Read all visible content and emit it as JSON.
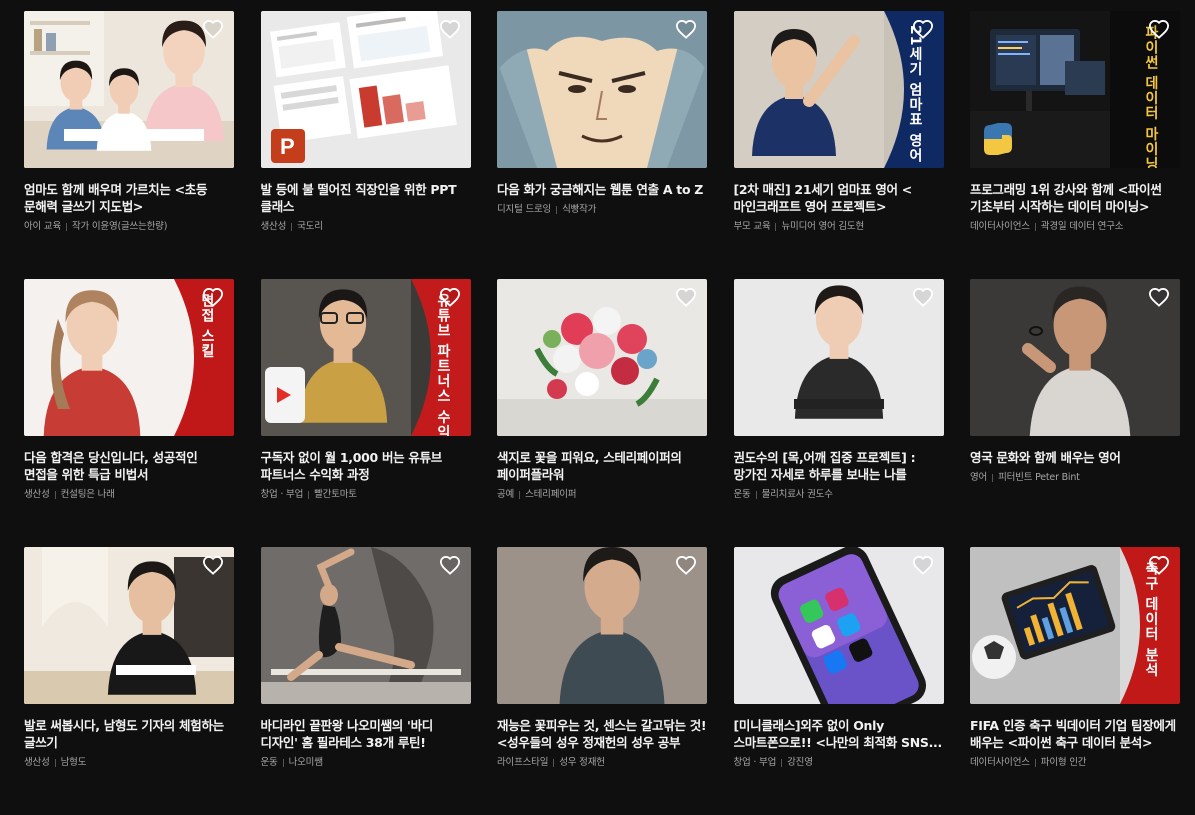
{
  "colors": {
    "background": "#0f0f0f",
    "accent_red": "#d21f1f",
    "accent_navy": "#0f2a63"
  },
  "cards": [
    {
      "title": "엄마도 함께 배우며 가르치는 <초등 문해력 글쓰기 지도법>",
      "category": "아이 교육",
      "creator": "작가 이윤영(글쓰는한량)",
      "overlay_text": "",
      "icon": "heart-outline-icon"
    },
    {
      "title": "발 등에 불 떨어진 직장인을 위한 PPT 클래스",
      "category": "생산성",
      "creator": "국도리",
      "overlay_text": "",
      "icon": "heart-outline-icon"
    },
    {
      "title": "다음 화가 궁금해지는 웹툰 연출 A to Z",
      "category": "디지털 드로잉",
      "creator": "식빵작가",
      "overlay_text": "",
      "icon": "heart-outline-icon"
    },
    {
      "title": "[2차 매진] 21세기 엄마표 영어 < 마인크래프트 영어 프로젝트>",
      "category": "부모 교육",
      "creator": "뉴미디어 영어 김도현",
      "overlay_text": "21세기 엄마표 영어",
      "icon": "heart-outline-icon"
    },
    {
      "title": "프로그래밍 1위 강사와 함께 <파이썬 기초부터 시작하는 데이터 마이닝>",
      "category": "데이터사이언스",
      "creator": "곽경일 데이터 연구소",
      "overlay_text": "파이썬 데이터 마이닝",
      "icon": "heart-outline-icon"
    },
    {
      "title": "다음 합격은 당신입니다, 성공적인 면접을 위한 특급 비법서",
      "category": "생산성",
      "creator": "컨설팅은 나래",
      "overlay_text": "면접 스킬",
      "icon": "heart-outline-icon"
    },
    {
      "title": "구독자 없이 월 1,000 버는 유튜브 파트너스 수익화 과정",
      "category": "창업 · 부업",
      "creator": "빨간토마토",
      "overlay_text": "유튜브 파트너스 수익화",
      "icon": "heart-outline-icon"
    },
    {
      "title": "색지로 꽃을 피워요, 스테리페이퍼의 페이퍼플라워",
      "category": "공예",
      "creator": "스테리페이퍼",
      "overlay_text": "",
      "icon": "heart-outline-icon"
    },
    {
      "title": "권도수의 [목,어깨 집중 프로젝트] : 망가진 자세로 하루를 보내는 나를 위한...",
      "category": "운동",
      "creator": "물리치료사 권도수",
      "overlay_text": "",
      "icon": "heart-outline-icon"
    },
    {
      "title": "영국 문화와 함께 배우는 영어",
      "category": "영어",
      "creator": "피터빈트 Peter Bint",
      "overlay_text": "",
      "icon": "heart-outline-icon"
    },
    {
      "title": "발로 써봅시다, 남형도 기자의 체험하는 글쓰기",
      "category": "생산성",
      "creator": "남형도",
      "overlay_text": "",
      "icon": "heart-outline-icon"
    },
    {
      "title": "바디라인 끝판왕 나오미쌤의 '바디 디자인' 홈 필라테스 38개 루틴!",
      "category": "운동",
      "creator": "나오미쌤",
      "overlay_text": "",
      "icon": "heart-outline-icon"
    },
    {
      "title": "재능은 꽃피우는 것, 센스는 갈고닦는 것! <성우들의 성우 정재헌의 성우 공부 비...",
      "category": "라이프스타일",
      "creator": "성우 정재헌",
      "overlay_text": "",
      "icon": "heart-outline-icon"
    },
    {
      "title": "[미니클래스]외주 없이 Only 스마트폰으로!! <나만의 최적화 SNS...",
      "category": "창업 · 부업",
      "creator": "강진영",
      "overlay_text": "",
      "icon": "heart-outline-icon"
    },
    {
      "title": "FIFA 인증 축구 빅데이터 기업 팀장에게 배우는 <파이썬 축구 데이터 분석>",
      "category": "데이터사이언스",
      "creator": "파이형 인간",
      "overlay_text": "축구 데이터 분석",
      "icon": "heart-outline-icon"
    }
  ]
}
